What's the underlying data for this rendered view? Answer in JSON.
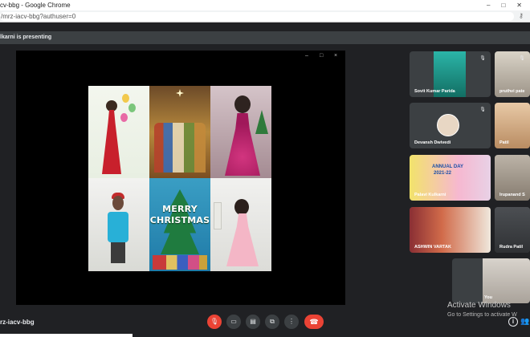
{
  "browser": {
    "title": "cv-bbg - Google Chrome",
    "url": "/mrz-iacv-bbg?authuser=0",
    "window_controls": [
      "–",
      "□",
      "✕"
    ]
  },
  "presenting_text": "lkarni is presenting",
  "stage": {
    "controls": [
      "–",
      "□",
      "×"
    ],
    "merry_text": "MERRY\nCHRISTMAS"
  },
  "participants": [
    {
      "name": "Sovit Kumar Parida"
    },
    {
      "name": "pruthvi pate"
    },
    {
      "name": "Devansh Dwivedi"
    },
    {
      "name": "Patil"
    },
    {
      "name": "Palavi Kulkarni",
      "slide_title": "ANNUAL DAY",
      "slide_year": "2021-22"
    },
    {
      "name": "Irupanand S"
    },
    {
      "name": "ASHWIN VARTAK"
    },
    {
      "name": "Rudra Patil"
    },
    {
      "name": "You"
    }
  ],
  "bottom_bar": {
    "meeting_code": "rz-iacv-bbg",
    "buttons": [
      "mic-off",
      "camera",
      "captions",
      "present",
      "more",
      "hang-up"
    ]
  },
  "watermark": {
    "line1": "Activate Windows",
    "line2": "Go to Settings to activate W"
  },
  "colors": {
    "meet_bg": "#202124",
    "tile_bg": "#3c4043",
    "danger": "#ea4335"
  }
}
